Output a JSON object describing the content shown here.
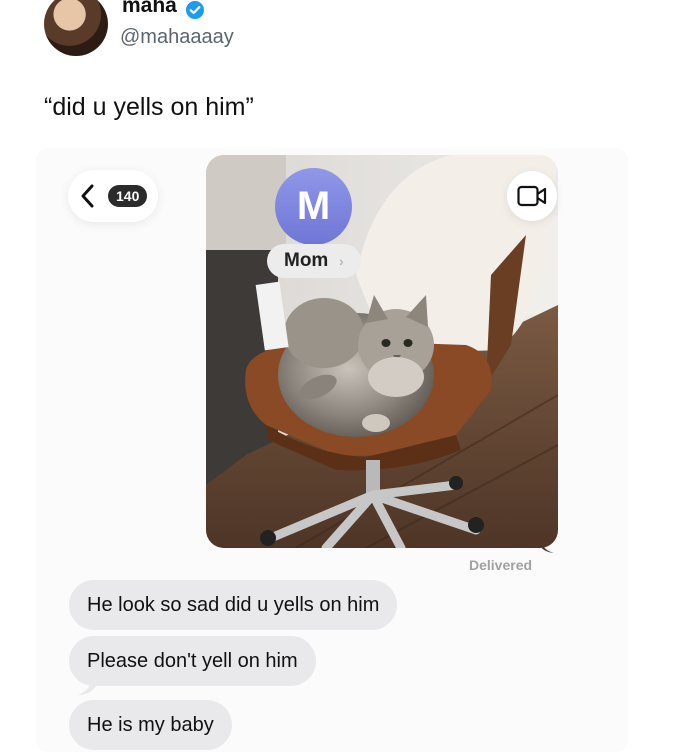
{
  "tweet": {
    "name": "maha",
    "handle": "@mahaaaay",
    "text": "“did u yells on him”"
  },
  "screenshot": {
    "header": {
      "unread_count": "140",
      "contact_initial": "M",
      "contact_name": "Mom",
      "contact_chevron": "›"
    },
    "photo": {
      "subject": "fluffy gray cat sitting on a brown office chair"
    },
    "status": "Delivered",
    "messages": [
      "He look so sad did u yells on him",
      "Please don't yell on him",
      "He is my baby"
    ],
    "icons": {
      "back": "chevron-left-icon",
      "video": "video-camera-icon",
      "verified": "verified-badge-icon"
    },
    "colors": {
      "verified": "#1d9bf0",
      "received_bubble": "#e9e9eb",
      "contact_avatar": "#7f87e0",
      "badge": "#2b2b2b"
    }
  }
}
